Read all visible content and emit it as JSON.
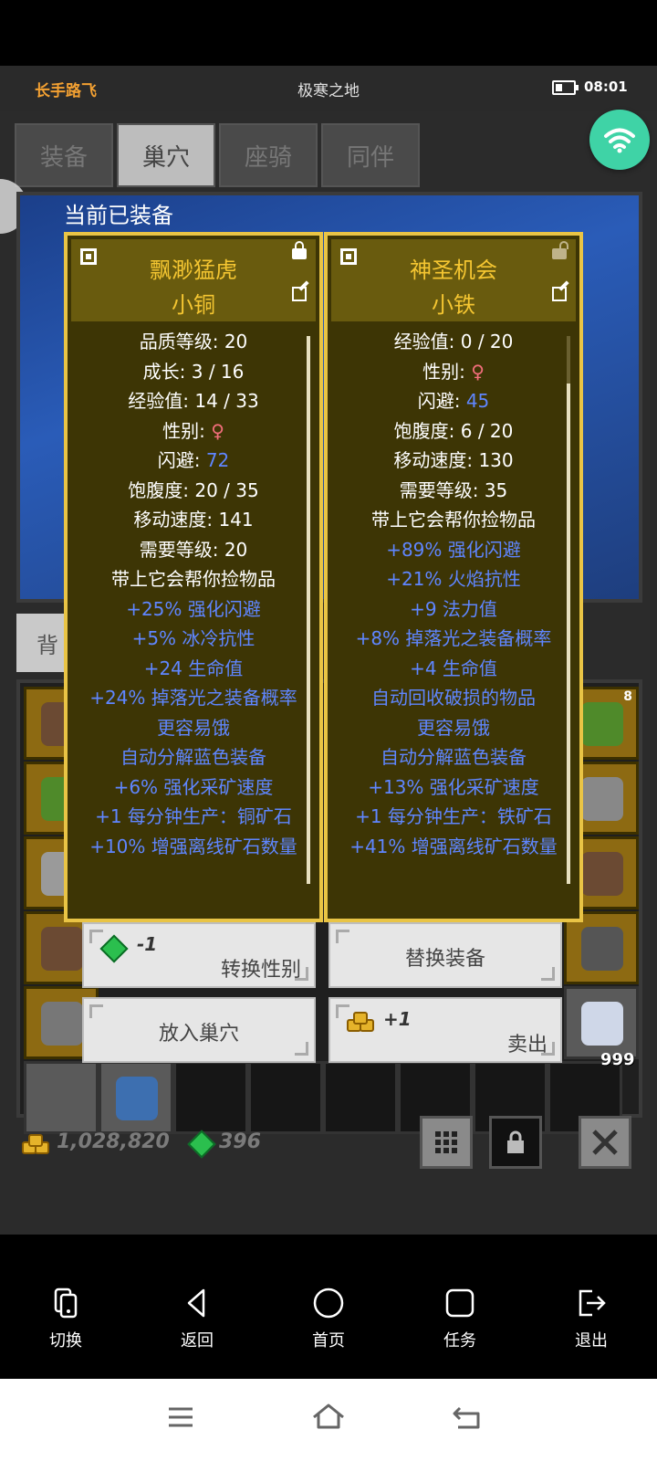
{
  "status_bar": {
    "player_name": "长手路飞",
    "zone": "极寒之地",
    "time": "08:01"
  },
  "tabs": [
    "装备",
    "巢穴",
    "座骑",
    "同伴"
  ],
  "active_tab": 1,
  "panel_title": "当前已装备",
  "bag_tab_label": "背",
  "cards": [
    {
      "name": "飘渺猛虎",
      "subtitle": "小铜",
      "locked": true,
      "stats": [
        {
          "label": "品质等级: ",
          "value": "20"
        },
        {
          "label": "成长: ",
          "value": "3 / 16"
        },
        {
          "label": "经验值: ",
          "value": "14 / 33"
        },
        {
          "label": "性别: ",
          "value": "♀",
          "value_color": "pink"
        },
        {
          "label": "闪避: ",
          "value": "72",
          "value_color": "blue"
        },
        {
          "label": "饱腹度: ",
          "value": "20 / 35"
        },
        {
          "label": "移动速度: ",
          "value": "141"
        },
        {
          "label": "需要等级: ",
          "value": "20"
        },
        {
          "label": "带上它会帮你捡物品",
          "value": ""
        },
        {
          "label": "+25% 强化闪避",
          "value": "",
          "color": "blue"
        },
        {
          "label": "+5% 冰冷抗性",
          "value": "",
          "color": "blue"
        },
        {
          "label": "+24 生命值",
          "value": "",
          "color": "blue"
        },
        {
          "label": "+24% 掉落光之装备概率",
          "value": "",
          "color": "blue"
        },
        {
          "label": "更容易饿",
          "value": "",
          "color": "blue"
        },
        {
          "label": "自动分解蓝色装备",
          "value": "",
          "color": "blue"
        },
        {
          "label": "+6% 强化采矿速度",
          "value": "",
          "color": "blue"
        },
        {
          "label": "+1 每分钟生产：铜矿石",
          "value": "",
          "color": "blue"
        },
        {
          "label": "+10% 增强离线矿石数量",
          "value": "",
          "color": "blue"
        }
      ]
    },
    {
      "name": "神圣机会",
      "subtitle": "小铁",
      "locked": false,
      "stats": [
        {
          "label": "经验值: ",
          "value": "0 / 20"
        },
        {
          "label": "性别: ",
          "value": "♀",
          "value_color": "pink"
        },
        {
          "label": "闪避: ",
          "value": "45",
          "value_color": "blue"
        },
        {
          "label": "饱腹度: ",
          "value": "6 / 20"
        },
        {
          "label": "移动速度: ",
          "value": "130"
        },
        {
          "label": "需要等级: ",
          "value": "35"
        },
        {
          "label": "带上它会帮你捡物品",
          "value": ""
        },
        {
          "label": "+89% 强化闪避",
          "value": "",
          "color": "blue"
        },
        {
          "label": "+21% 火焰抗性",
          "value": "",
          "color": "blue"
        },
        {
          "label": "+9 法力值",
          "value": "",
          "color": "blue"
        },
        {
          "label": "+8% 掉落光之装备概率",
          "value": "",
          "color": "blue"
        },
        {
          "label": "+4 生命值",
          "value": "",
          "color": "blue"
        },
        {
          "label": "自动回收破损的物品",
          "value": "",
          "color": "blue"
        },
        {
          "label": "更容易饿",
          "value": "",
          "color": "blue"
        },
        {
          "label": "自动分解蓝色装备",
          "value": "",
          "color": "blue"
        },
        {
          "label": "+13% 强化采矿速度",
          "value": "",
          "color": "blue"
        },
        {
          "label": "+1 每分钟生产：铁矿石",
          "value": "",
          "color": "blue"
        },
        {
          "label": "+41% 增强离线矿石数量",
          "value": "",
          "color": "blue"
        }
      ]
    }
  ],
  "actions": {
    "change_gender": {
      "cost": "-1",
      "label": "转换性别"
    },
    "replace_equip": {
      "label": "替换装备"
    },
    "put_in_nest": {
      "label": "放入巢穴"
    },
    "sell": {
      "reward": "+1",
      "label": "卖出"
    }
  },
  "inventory": {
    "stack_count": "999",
    "slot_badge": "8"
  },
  "currency": {
    "gold": "1,028,820",
    "gems": "396"
  },
  "nav": [
    "切换",
    "返回",
    "首页",
    "任务",
    "退出"
  ],
  "colors": {
    "gold_text": "#f5c631",
    "blue_stat": "#5f86ff",
    "card_border": "#e9c445",
    "wifi": "#3fd3a6"
  }
}
